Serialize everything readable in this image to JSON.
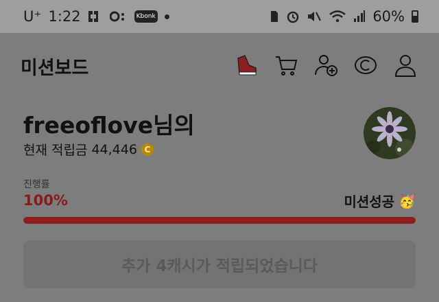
{
  "status_bar": {
    "carrier": "U⁺",
    "time": "1:22",
    "app_badge": "Kbonk",
    "battery": "60%",
    "battery_level": 0.6
  },
  "header": {
    "title": "미션보드",
    "icons": [
      "running-shoe-icon",
      "cart-icon",
      "add-friend-icon",
      "coin-icon",
      "profile-icon"
    ]
  },
  "user": {
    "name": "freeoflove님의",
    "points_label": "현재 적립금",
    "points_value": "44,446"
  },
  "progress": {
    "label": "진행률",
    "value_text": "100%",
    "fraction": 1.0,
    "mission_status": "미션성공",
    "status_emoji": "🥳"
  },
  "notice": {
    "text": "추가 4캐시가 적립되었습니다"
  },
  "colors": {
    "accent": "#8e1e1e",
    "dim_overlay": "#7d7d7d"
  }
}
